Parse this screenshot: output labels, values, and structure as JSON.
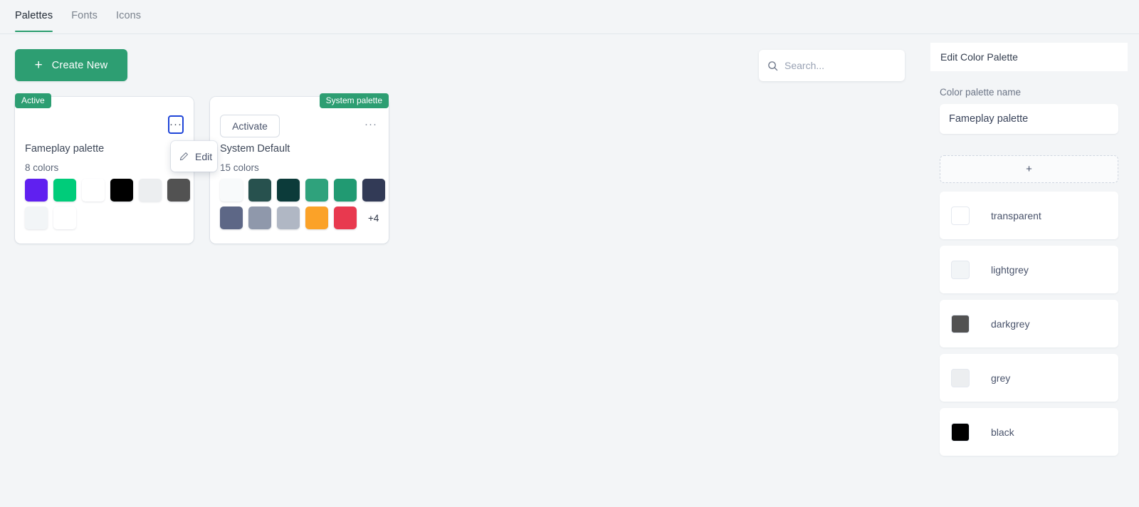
{
  "tabs": [
    {
      "label": "Palettes",
      "active": true
    },
    {
      "label": "Fonts",
      "active": false
    },
    {
      "label": "Icons",
      "active": false
    }
  ],
  "toolbar": {
    "create_label": "Create New",
    "create_icon": "plus-icon",
    "create_color": "#2d9e72"
  },
  "search": {
    "placeholder": "Search...",
    "value": "",
    "icon": "search-icon"
  },
  "cards": [
    {
      "badge": "Active",
      "badge_color": "#2d9e72",
      "title": "Fameplay palette",
      "count_label": "8 colors",
      "menu_icon": "ellipsis-icon",
      "menu_focused": true,
      "swatches": [
        "#6020f0",
        "#00cc7a",
        "#ffffff",
        "#000000",
        "#eceef0",
        "#525252",
        "#f2f5f7",
        "#ffffff"
      ],
      "overflow_label": ""
    },
    {
      "badge": "System palette",
      "badge_color": "#2d9e72",
      "activate_label": "Activate",
      "title": "System Default",
      "count_label": "15 colors",
      "menu_icon": "ellipsis-icon",
      "menu_focused": false,
      "swatches": [
        "#f8fafb",
        "#27514e",
        "#0c3b3a",
        "#2fa27c",
        "#219a72",
        "#323a56",
        "#5d6786",
        "#8f98ab",
        "#b0b7c4",
        "#fba228",
        "#e8394f"
      ],
      "overflow_label": "+4"
    }
  ],
  "context_menu": {
    "items": [
      {
        "label": "Edit",
        "icon": "pencil-icon"
      }
    ]
  },
  "panel": {
    "title": "Edit Color Palette",
    "name_field_label": "Color palette name",
    "name_value": "Fameplay palette",
    "add_button_label": "+",
    "colors": [
      {
        "name": "transparent",
        "hex": "#ffffff"
      },
      {
        "name": "lightgrey",
        "hex": "#f2f5f7"
      },
      {
        "name": "darkgrey",
        "hex": "#525252"
      },
      {
        "name": "grey",
        "hex": "#eceef0"
      },
      {
        "name": "black",
        "hex": "#000000"
      }
    ]
  }
}
